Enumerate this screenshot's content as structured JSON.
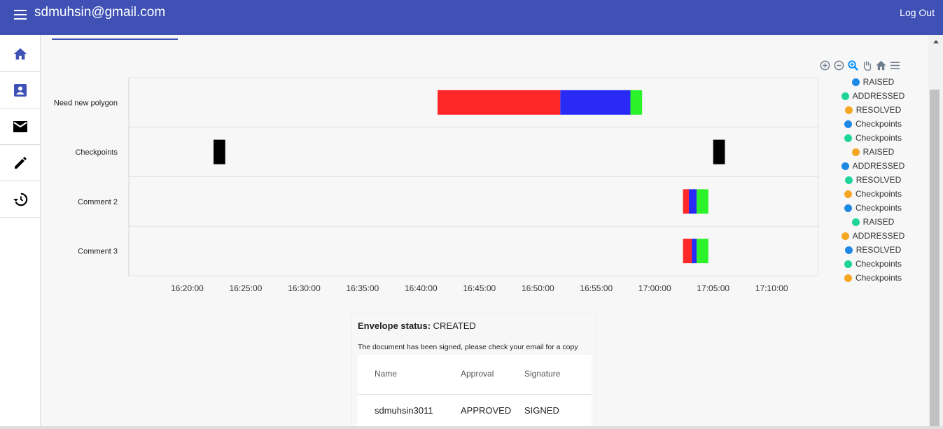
{
  "header": {
    "user_email": "sdmuhsin@gmail.com",
    "logout_label": "Log Out",
    "bg": "#3f51b5"
  },
  "sidebar": {
    "items": [
      {
        "icon": "home-icon"
      },
      {
        "icon": "contact-card-icon"
      },
      {
        "icon": "mail-icon"
      },
      {
        "icon": "pencil-icon"
      },
      {
        "icon": "history-icon"
      }
    ]
  },
  "chart_data": {
    "type": "timeline",
    "rows": [
      "Need new polygon",
      "Checkpoints",
      "Comment 2",
      "Comment 3"
    ],
    "x_ticks": [
      "16:20:00",
      "16:25:00",
      "16:30:00",
      "16:35:00",
      "16:40:00",
      "16:45:00",
      "16:50:00",
      "16:55:00",
      "17:00:00",
      "17:05:00",
      "17:10:00"
    ],
    "x_range": [
      "16:15:00",
      "17:14:00"
    ],
    "grid": true,
    "segments": [
      {
        "row": "Need new polygon",
        "start": "16:41:25",
        "end": "16:51:55",
        "color": "#ff2727"
      },
      {
        "row": "Need new polygon",
        "start": "16:51:55",
        "end": "16:57:55",
        "color": "#2a2af7"
      },
      {
        "row": "Need new polygon",
        "start": "16:57:55",
        "end": "16:58:55",
        "color": "#2cf22c"
      },
      {
        "row": "Checkpoints",
        "start": "16:22:15",
        "end": "16:23:15",
        "color": "#000000"
      },
      {
        "row": "Checkpoints",
        "start": "17:05:00",
        "end": "17:06:00",
        "color": "#000000"
      },
      {
        "row": "Comment 2",
        "start": "17:02:25",
        "end": "17:02:55",
        "color": "#ff2727"
      },
      {
        "row": "Comment 2",
        "start": "17:02:55",
        "end": "17:03:35",
        "color": "#2a2af7"
      },
      {
        "row": "Comment 2",
        "start": "17:03:35",
        "end": "17:04:35",
        "color": "#2cf22c"
      },
      {
        "row": "Comment 3",
        "start": "17:02:25",
        "end": "17:03:10",
        "color": "#ff2727"
      },
      {
        "row": "Comment 3",
        "start": "17:03:10",
        "end": "17:03:35",
        "color": "#2a2af7"
      },
      {
        "row": "Comment 3",
        "start": "17:03:35",
        "end": "17:04:35",
        "color": "#2cf22c"
      }
    ],
    "legend": [
      {
        "label": "RAISED",
        "color": "#1e88e5"
      },
      {
        "label": "ADDRESSED",
        "color": "#1ed49a"
      },
      {
        "label": "RESOLVED",
        "color": "#f5a623"
      },
      {
        "label": "Checkpoints",
        "color": "#1e88e5"
      },
      {
        "label": "Checkpoints",
        "color": "#1ed49a"
      },
      {
        "label": "RAISED",
        "color": "#f5a623"
      },
      {
        "label": "ADDRESSED",
        "color": "#1e88e5"
      },
      {
        "label": "RESOLVED",
        "color": "#1ed49a"
      },
      {
        "label": "Checkpoints",
        "color": "#f5a623"
      },
      {
        "label": "Checkpoints",
        "color": "#1e88e5"
      },
      {
        "label": "RAISED",
        "color": "#1ed49a"
      },
      {
        "label": "ADDRESSED",
        "color": "#f5a623"
      },
      {
        "label": "RESOLVED",
        "color": "#1e88e5"
      },
      {
        "label": "Checkpoints",
        "color": "#1ed49a"
      },
      {
        "label": "Checkpoints",
        "color": "#f5a623"
      }
    ],
    "legend_position": "right"
  },
  "toolbar": {
    "tools": [
      "zoom-in-icon",
      "zoom-out-icon",
      "zoom-select-icon",
      "pan-hand-icon",
      "reset-home-icon",
      "menu-icon"
    ]
  },
  "envelope": {
    "status_label": "Envelope status:",
    "status_value": "CREATED",
    "message": "The document has been signed, please check your email for a copy",
    "columns": [
      "Name",
      "Approval",
      "Signature"
    ],
    "row": {
      "name": "sdmuhsin3011",
      "approval": "APPROVED",
      "signature": "SIGNED"
    }
  }
}
